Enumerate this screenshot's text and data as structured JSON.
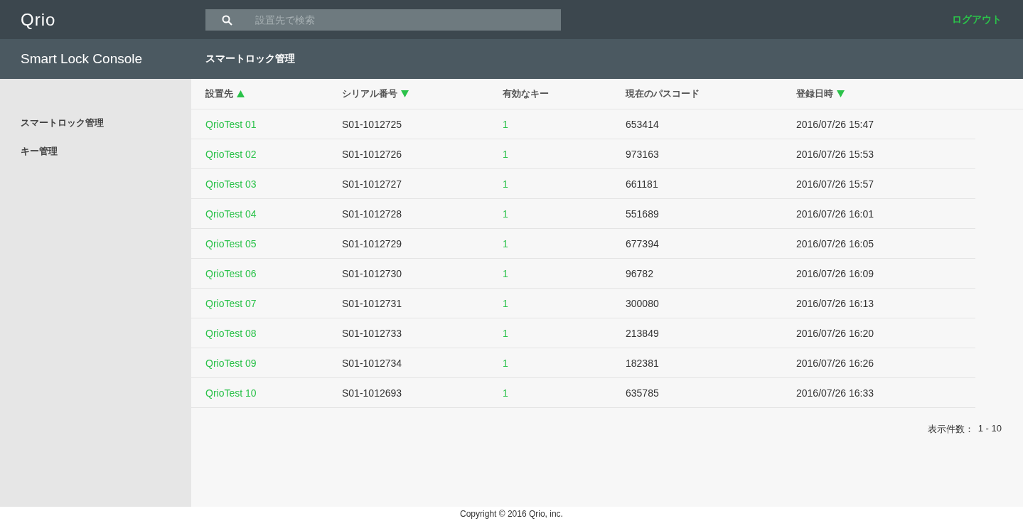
{
  "header": {
    "logo": "Qrio",
    "search": {
      "placeholder": "設置先で検索"
    },
    "logout": "ログアウト"
  },
  "subheader": {
    "app_name": "Smart Lock Console",
    "page_title": "スマートロック管理"
  },
  "sidebar": {
    "items": [
      {
        "label": "スマートロック管理"
      },
      {
        "label": "キー管理"
      }
    ]
  },
  "table": {
    "columns": [
      {
        "label": "設置先",
        "sorted_ascending": true,
        "sorted_descending": false
      },
      {
        "label": "シリアル番号",
        "sorted_ascending": false,
        "sorted_descending": true
      },
      {
        "label": "有効なキー",
        "sorted_ascending": false,
        "sorted_descending": false
      },
      {
        "label": "現在のパスコード",
        "sorted_ascending": false,
        "sorted_descending": false
      },
      {
        "label": "登録日時",
        "sorted_ascending": false,
        "sorted_descending": true
      }
    ],
    "rows": [
      {
        "location": "QrioTest 01",
        "serial": "S01-1012725",
        "keys": "1",
        "passcode": "653414",
        "registered": "2016/07/26 15:47"
      },
      {
        "location": "QrioTest 02",
        "serial": "S01-1012726",
        "keys": "1",
        "passcode": "973163",
        "registered": "2016/07/26 15:53"
      },
      {
        "location": "QrioTest 03",
        "serial": "S01-1012727",
        "keys": "1",
        "passcode": "661181",
        "registered": "2016/07/26 15:57"
      },
      {
        "location": "QrioTest 04",
        "serial": "S01-1012728",
        "keys": "1",
        "passcode": "551689",
        "registered": "2016/07/26 16:01"
      },
      {
        "location": "QrioTest 05",
        "serial": "S01-1012729",
        "keys": "1",
        "passcode": "677394",
        "registered": "2016/07/26 16:05"
      },
      {
        "location": "QrioTest 06",
        "serial": "S01-1012730",
        "keys": "1",
        "passcode": "96782",
        "registered": "2016/07/26 16:09"
      },
      {
        "location": "QrioTest 07",
        "serial": "S01-1012731",
        "keys": "1",
        "passcode": "300080",
        "registered": "2016/07/26 16:13"
      },
      {
        "location": "QrioTest 08",
        "serial": "S01-1012733",
        "keys": "1",
        "passcode": "213849",
        "registered": "2016/07/26 16:20"
      },
      {
        "location": "QrioTest 09",
        "serial": "S01-1012734",
        "keys": "1",
        "passcode": "182381",
        "registered": "2016/07/26 16:26"
      },
      {
        "location": "QrioTest 10",
        "serial": "S01-1012693",
        "keys": "1",
        "passcode": "635785",
        "registered": "2016/07/26 16:33"
      }
    ]
  },
  "pagination": {
    "label": "表示件数：",
    "range": "1 - 10"
  },
  "footer": {
    "copyright": "Copyright © 2016 Qrio, inc."
  }
}
